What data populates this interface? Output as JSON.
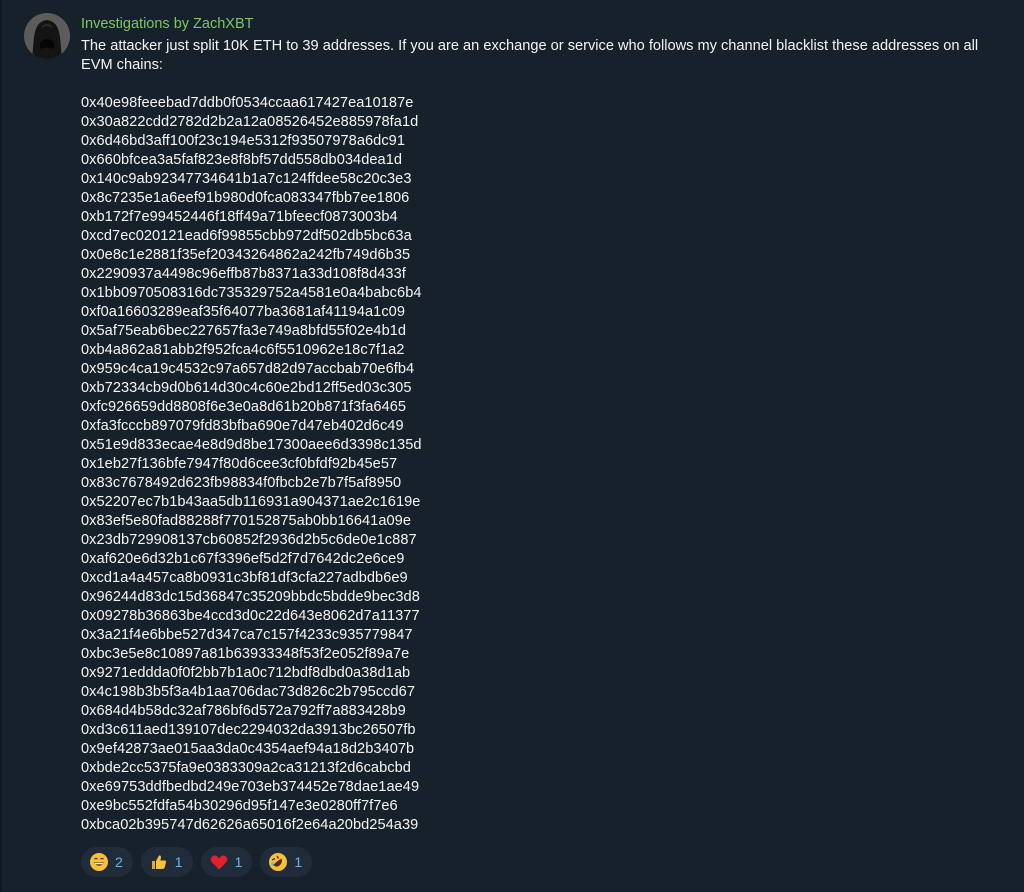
{
  "message": {
    "sender": "Investigations by ZachXBT",
    "intro": "The attacker just split 10K ETH to 39 addresses. If you are an exchange or service who follows my channel blacklist these addresses on all EVM chains:",
    "addresses": [
      "0x40e98feeebad7ddb0f0534ccaa617427ea10187e",
      "0x30a822cdd2782d2b2a12a08526452e885978fa1d",
      "0x6d46bd3aff100f23c194e5312f93507978a6dc91",
      "0x660bfcea3a5faf823e8f8bf57dd558db034dea1d",
      "0x140c9ab92347734641b1a7c124ffdee58c20c3e3",
      "0x8c7235e1a6eef91b980d0fca083347fbb7ee1806",
      "0xb172f7e99452446f18ff49a71bfeecf0873003b4",
      "0xcd7ec020121ead6f99855cbb972df502db5bc63a",
      "0x0e8c1e2881f35ef20343264862a242fb749d6b35",
      "0x2290937a4498c96effb87b8371a33d108f8d433f",
      "0x1bb0970508316dc735329752a4581e0a4babc6b4",
      "0xf0a16603289eaf35f64077ba3681af41194a1c09",
      "0x5af75eab6bec227657fa3e749a8bfd55f02e4b1d",
      "0xb4a862a81abb2f952fca4c6f5510962e18c7f1a2",
      "0x959c4ca19c4532c97a657d82d97accbab70e6fb4",
      "0xb72334cb9d0b614d30c4c60e2bd12ff5ed03c305",
      "0xfc926659dd8808f6e3e0a8d61b20b871f3fa6465",
      "0xfa3fcccb897079fd83bfba690e7d47eb402d6c49",
      "0x51e9d833ecae4e8d9d8be17300aee6d3398c135d",
      "0x1eb27f136bfe7947f80d6cee3cf0bfdf92b45e57",
      "0x83c7678492d623fb98834f0fbcb2e7b7f5af8950",
      "0x52207ec7b1b43aa5db116931a904371ae2c1619e",
      "0x83ef5e80fad88288f770152875ab0bb16641a09e",
      "0x23db729908137cb60852f2936d2b5c6de0e1c887",
      "0xaf620e6d32b1c67f3396ef5d2f7d7642dc2e6ce9",
      "0xcd1a4a457ca8b0931c3bf81df3cfa227adbdb6e9",
      "0x96244d83dc15d36847c35209bbdc5bdde9bec3d8",
      "0x09278b36863be4ccd3d0c22d643e8062d7a11377",
      "0x3a21f4e6bbe527d347ca7c157f4233c935779847",
      "0xbc3e5e8c10897a81b63933348f53f2e052f89a7e",
      "0x9271eddda0f0f2bb7b1a0c712bdf8dbd0a38d1ab",
      "0x4c198b3b5f3a4b1aa706dac73d826c2b795ccd67",
      "0x684d4b58dc32af786bf6d572a792ff7a883428b9",
      "0xd3c611aed139107dec2294032da3913bc26507fb",
      "0x9ef42873ae015aa3da0c4354aef94a18d2b3407b",
      "0xbde2cc5375fa9e0383309a2ca31213f2d6cabcbd",
      "0xe69753ddfbedbd249e703eb374452e78dae1ae49",
      "0xe9bc552fdfa54b30296d95f147e3e0280ff7f7e6",
      "0xbca02b395747d62626a65016f2e64a20bd254a39"
    ]
  },
  "reactions": [
    {
      "emoji": "grinning-face",
      "count": "2"
    },
    {
      "emoji": "thumbs-up",
      "count": "1"
    },
    {
      "emoji": "red-heart",
      "count": "1"
    },
    {
      "emoji": "rolling-on-floor-laughing",
      "count": "1"
    }
  ],
  "colors": {
    "background": "#17212b",
    "sender": "#7bc862",
    "text": "#f5f5f5",
    "reaction_bg": "#202c3a",
    "reaction_count": "#6ab3f3"
  }
}
